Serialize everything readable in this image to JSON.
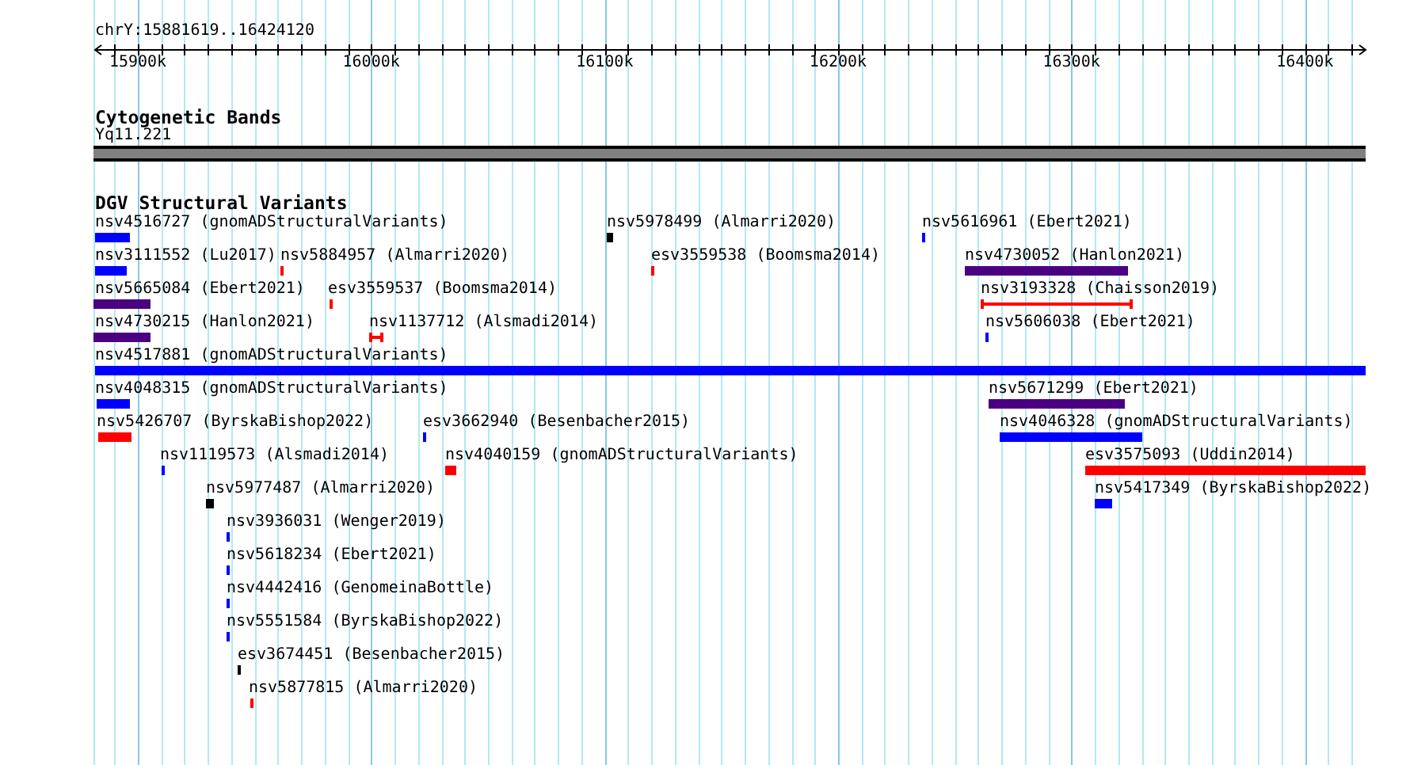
{
  "ruler": {
    "location": "chrY:15881619..16424120",
    "ticks": [
      "15900k",
      "16000k",
      "16100k",
      "16200k",
      "16300k",
      "16400k"
    ]
  },
  "tracks": [
    {
      "title": "Cytogenetic Bands",
      "features": [
        {
          "label": "Yq11.221",
          "kind": "band",
          "color": "#808080"
        }
      ]
    },
    {
      "title": "DGV Structural Variants",
      "features": [
        {
          "label": "nsv4516727 (gnomADStructuralVariants)",
          "kind": "bar",
          "color": "#0000ff"
        },
        {
          "label": "nsv5978499 (Almarri2020)",
          "kind": "bar",
          "color": "#000000"
        },
        {
          "label": "nsv5616961 (Ebert2021)",
          "kind": "bar",
          "color": "#0000ff"
        },
        {
          "label": "nsv3111552 (Lu2017)",
          "kind": "bar",
          "color": "#0000ff"
        },
        {
          "label": "nsv5884957 (Almarri2020)",
          "kind": "bar",
          "color": "#ff0000"
        },
        {
          "label": "esv3559538 (Boomsma2014)",
          "kind": "bar",
          "color": "#ff0000"
        },
        {
          "label": "nsv4730052 (Hanlon2021)",
          "kind": "bar",
          "color": "#4b0082"
        },
        {
          "label": "nsv5665084 (Ebert2021)",
          "kind": "bar",
          "color": "#4b0082"
        },
        {
          "label": "esv3559537 (Boomsma2014)",
          "kind": "bar",
          "color": "#ff0000"
        },
        {
          "label": "nsv3193328 (Chaisson2019)",
          "kind": "span",
          "color": "#ff0000"
        },
        {
          "label": "nsv4730215 (Hanlon2021)",
          "kind": "bar",
          "color": "#4b0082"
        },
        {
          "label": "nsv1137712 (Alsmadi2014)",
          "kind": "span",
          "color": "#ff0000"
        },
        {
          "label": "nsv5606038 (Ebert2021)",
          "kind": "bar",
          "color": "#0000ff"
        },
        {
          "label": "nsv4517881 (gnomADStructuralVariants)",
          "kind": "bar",
          "color": "#0000ff"
        },
        {
          "label": "nsv4048315 (gnomADStructuralVariants)",
          "kind": "bar",
          "color": "#0000ff"
        },
        {
          "label": "nsv5671299 (Ebert2021)",
          "kind": "bar",
          "color": "#4b0082"
        },
        {
          "label": "nsv5426707 (ByrskaBishop2022)",
          "kind": "bar",
          "color": "#ff0000"
        },
        {
          "label": "esv3662940 (Besenbacher2015)",
          "kind": "bar",
          "color": "#0000ff"
        },
        {
          "label": "nsv4046328 (gnomADStructuralVariants)",
          "kind": "bar",
          "color": "#0000ff"
        },
        {
          "label": "nsv1119573 (Alsmadi2014)",
          "kind": "bar",
          "color": "#0000ff"
        },
        {
          "label": "nsv4040159 (gnomADStructuralVariants)",
          "kind": "bar",
          "color": "#ff0000"
        },
        {
          "label": "esv3575093 (Uddin2014)",
          "kind": "bar",
          "color": "#ff0000"
        },
        {
          "label": "nsv5977487 (Almarri2020)",
          "kind": "bar",
          "color": "#000000"
        },
        {
          "label": "nsv5417349 (ByrskaBishop2022)",
          "kind": "bar",
          "color": "#0000ff"
        },
        {
          "label": "nsv3936031 (Wenger2019)",
          "kind": "bar",
          "color": "#0000ff"
        },
        {
          "label": "nsv5618234 (Ebert2021)",
          "kind": "bar",
          "color": "#0000ff"
        },
        {
          "label": "nsv4442416 (GenomeinaBottle)",
          "kind": "bar",
          "color": "#0000ff"
        },
        {
          "label": "nsv5551584 (ByrskaBishop2022)",
          "kind": "bar",
          "color": "#0000ff"
        },
        {
          "label": "esv3674451 (Besenbacher2015)",
          "kind": "bar",
          "color": "#000000"
        },
        {
          "label": "nsv5877815 (Almarri2020)",
          "kind": "bar",
          "color": "#ff0000"
        }
      ]
    }
  ]
}
